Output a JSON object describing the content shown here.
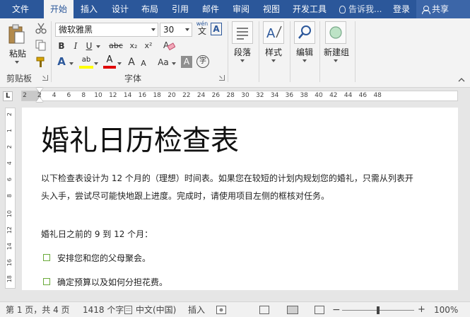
{
  "tabs": [
    "文件",
    "开始",
    "插入",
    "设计",
    "布局",
    "引用",
    "邮件",
    "审阅",
    "视图",
    "开发工具"
  ],
  "tell_me": "告诉我...",
  "login": "登录",
  "share": "共享",
  "ribbon": {
    "clipboard": {
      "paste": "粘贴",
      "group": "剪贴板"
    },
    "font": {
      "name": "微软雅黑",
      "size": "30",
      "wen": "wén",
      "wen_char": "文",
      "A_box": "A",
      "bold": "B",
      "italic": "I",
      "underline": "U",
      "strike": "abc",
      "sub": "x₂",
      "sup": "x²",
      "text_effect": "A",
      "highlight": "ab",
      "font_color": "A",
      "grow": "A",
      "shrink": "A",
      "case": "Aa",
      "shade": "A",
      "circle": "字",
      "group": "字体"
    },
    "paragraph": "段落",
    "styles": "样式",
    "editing": "编辑",
    "newgroup": "新建组"
  },
  "ruler": {
    "tab_selector": "L",
    "h_ticks": [
      "2",
      "2",
      "4",
      "6",
      "8",
      "10",
      "12",
      "14",
      "16",
      "18",
      "20",
      "22",
      "24",
      "26",
      "28",
      "30",
      "32",
      "34",
      "36",
      "38",
      "40",
      "42",
      "44",
      "46",
      "48"
    ],
    "v_ticks": [
      "2",
      "1",
      "2",
      "4",
      "6",
      "8",
      "10",
      "12",
      "14",
      "16",
      "18"
    ]
  },
  "document": {
    "title": "婚礼日历检查表",
    "para1_line1": "以下检查表设计为 12 个月的（理想）时间表。如果您在较短的计划内规划您的婚礼，只需从列表开",
    "para1_line2": "头入手，尝试尽可能快地跟上进度。完成时，请使用项目左侧的框核对任务。",
    "section": "婚礼日之前的 9 到 12 个月：",
    "items": [
      "安排您和您的父母聚会。",
      "确定预算以及如何分担花费。"
    ]
  },
  "status": {
    "page": "第 1 页，共 4 页",
    "words": "1418 个字",
    "lang": "中文(中国)",
    "mode": "插入",
    "zoom_minus": "−",
    "zoom_plus": "+",
    "zoom": "100%"
  },
  "colors": {
    "brand": "#2b579a",
    "highlight": "#ffff00",
    "font_color": "#e00000",
    "checkbox": "#6aaa3a"
  }
}
